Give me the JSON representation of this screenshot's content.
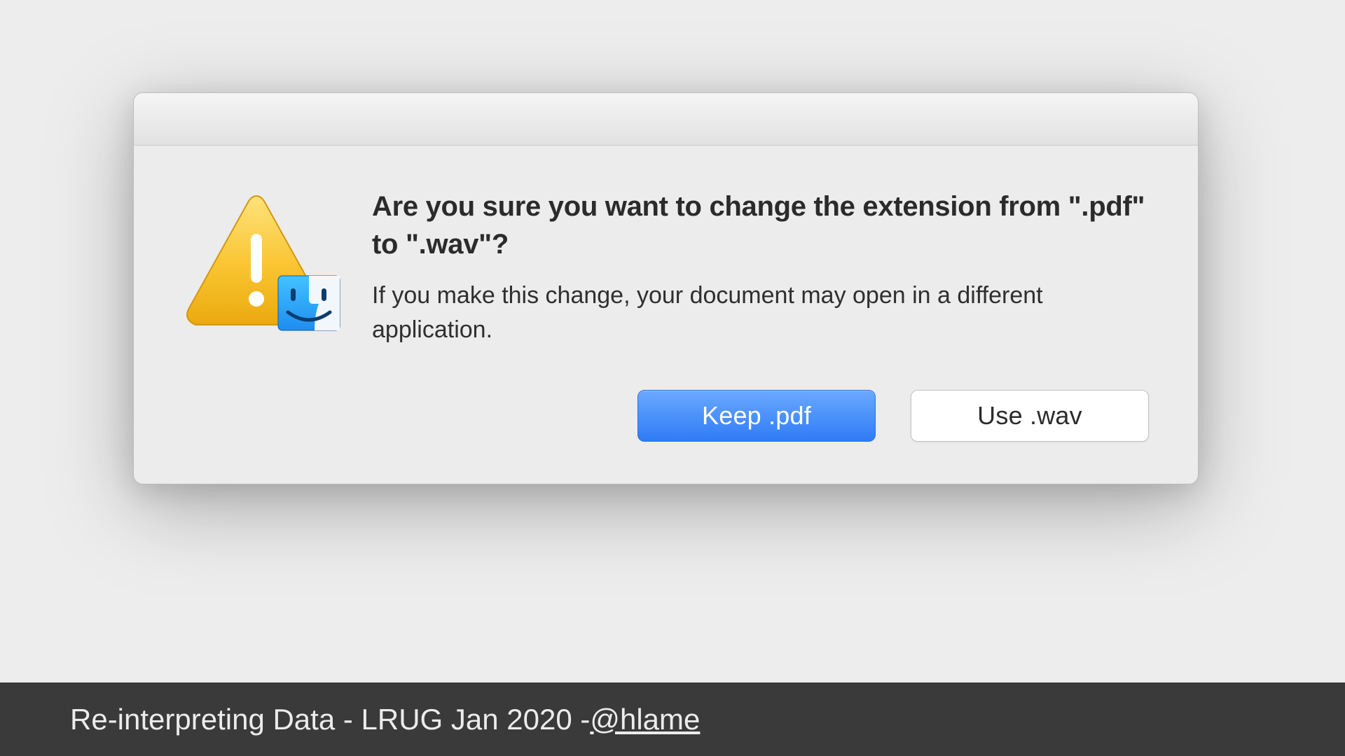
{
  "dialog": {
    "heading": "Are you sure you want to change the extension from \".pdf\" to \".wav\"?",
    "description": "If you make this change, your document may open in a different application.",
    "primary_button": "Keep .pdf",
    "secondary_button": "Use .wav"
  },
  "footer": {
    "prefix": "Re-interpreting Data - LRUG Jan 2020 - ",
    "handle": "@hlame"
  },
  "icons": {
    "warning": "warning-triangle-icon",
    "finder": "finder-icon"
  }
}
